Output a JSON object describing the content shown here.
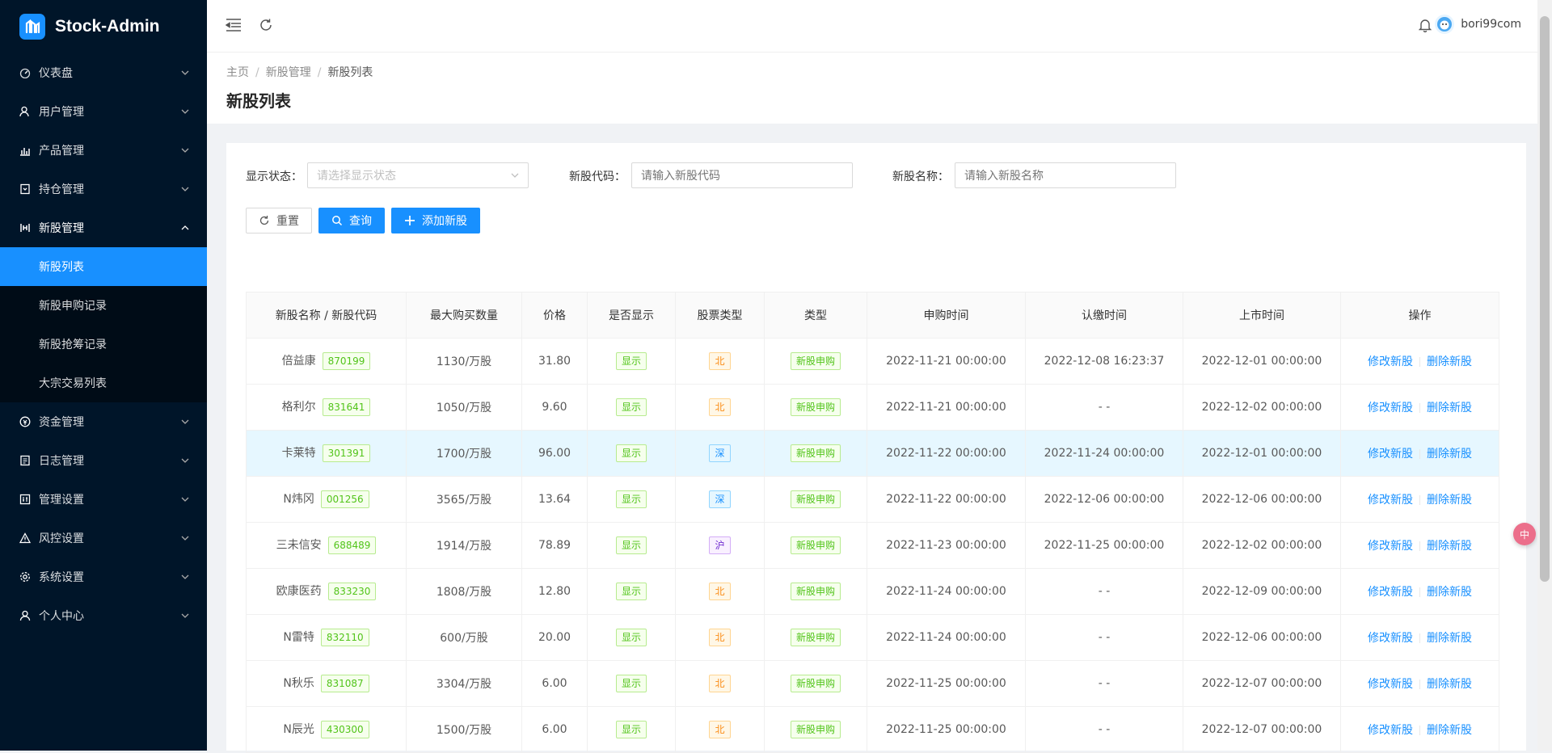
{
  "app": {
    "title": "Stock-Admin"
  },
  "sidebar": {
    "items": [
      {
        "label": "仪表盘",
        "icon": "dashboard-icon"
      },
      {
        "label": "用户管理",
        "icon": "user-manage-icon"
      },
      {
        "label": "产品管理",
        "icon": "chart-icon"
      },
      {
        "label": "持仓管理",
        "icon": "position-icon"
      },
      {
        "label": "新股管理",
        "icon": "ipo-icon",
        "expanded": true,
        "children": [
          {
            "label": "新股列表",
            "active": true
          },
          {
            "label": "新股申购记录"
          },
          {
            "label": "新股抢筹记录"
          },
          {
            "label": "大宗交易列表"
          }
        ]
      },
      {
        "label": "资金管理",
        "icon": "money-icon"
      },
      {
        "label": "日志管理",
        "icon": "log-icon"
      },
      {
        "label": "管理设置",
        "icon": "admin-settings-icon"
      },
      {
        "label": "风控设置",
        "icon": "warning-icon"
      },
      {
        "label": "系统设置",
        "icon": "gear-icon"
      },
      {
        "label": "个人中心",
        "icon": "person-icon"
      }
    ]
  },
  "header": {
    "username": "bori99com"
  },
  "breadcrumb": {
    "home": "主页",
    "parent": "新股管理",
    "current": "新股列表"
  },
  "page": {
    "title": "新股列表"
  },
  "filters": {
    "status_label": "显示状态：",
    "status_placeholder": "请选择显示状态",
    "code_label": "新股代码：",
    "code_placeholder": "请输入新股代码",
    "name_label": "新股名称：",
    "name_placeholder": "请输入新股名称"
  },
  "buttons": {
    "reset": "重置",
    "search": "查询",
    "add": "添加新股"
  },
  "table": {
    "headers": [
      "新股名称 / 新股代码",
      "最大购买数量",
      "价格",
      "是否显示",
      "股票类型",
      "类型",
      "申购时间",
      "认缴时间",
      "上市时间",
      "操作"
    ],
    "rows": [
      {
        "name": "倍益康",
        "code": "870199",
        "max": "1130/万股",
        "price": "31.80",
        "show": "显示",
        "market": "北",
        "type": "新股申购",
        "sub_time": "2022-11-21 00:00:00",
        "pay_time": "2022-12-08 16:23:37",
        "list_time": "2022-12-01 00:00:00"
      },
      {
        "name": "格利尔",
        "code": "831641",
        "max": "1050/万股",
        "price": "9.60",
        "show": "显示",
        "market": "北",
        "type": "新股申购",
        "sub_time": "2022-11-21 00:00:00",
        "pay_time": "- -",
        "list_time": "2022-12-02 00:00:00"
      },
      {
        "name": "卡莱特",
        "code": "301391",
        "max": "1700/万股",
        "price": "96.00",
        "show": "显示",
        "market": "深",
        "type": "新股申购",
        "sub_time": "2022-11-22 00:00:00",
        "pay_time": "2022-11-24 00:00:00",
        "list_time": "2022-12-01 00:00:00"
      },
      {
        "name": "N炜冈",
        "code": "001256",
        "max": "3565/万股",
        "price": "13.64",
        "show": "显示",
        "market": "深",
        "type": "新股申购",
        "sub_time": "2022-11-22 00:00:00",
        "pay_time": "2022-12-06 00:00:00",
        "list_time": "2022-12-06 00:00:00"
      },
      {
        "name": "三未信安",
        "code": "688489",
        "max": "1914/万股",
        "price": "78.89",
        "show": "显示",
        "market": "沪",
        "type": "新股申购",
        "sub_time": "2022-11-23 00:00:00",
        "pay_time": "2022-11-25 00:00:00",
        "list_time": "2022-12-02 00:00:00"
      },
      {
        "name": "欧康医药",
        "code": "833230",
        "max": "1808/万股",
        "price": "12.80",
        "show": "显示",
        "market": "北",
        "type": "新股申购",
        "sub_time": "2022-11-24 00:00:00",
        "pay_time": "- -",
        "list_time": "2022-12-09 00:00:00"
      },
      {
        "name": "N雷特",
        "code": "832110",
        "max": "600/万股",
        "price": "20.00",
        "show": "显示",
        "market": "北",
        "type": "新股申购",
        "sub_time": "2022-11-24 00:00:00",
        "pay_time": "- -",
        "list_time": "2022-12-06 00:00:00"
      },
      {
        "name": "N秋乐",
        "code": "831087",
        "max": "3304/万股",
        "price": "6.00",
        "show": "显示",
        "market": "北",
        "type": "新股申购",
        "sub_time": "2022-11-25 00:00:00",
        "pay_time": "- -",
        "list_time": "2022-12-07 00:00:00"
      },
      {
        "name": "N辰光",
        "code": "430300",
        "max": "1500/万股",
        "price": "6.00",
        "show": "显示",
        "market": "北",
        "type": "新股申购",
        "sub_time": "2022-11-25 00:00:00",
        "pay_time": "- -",
        "list_time": "2022-12-07 00:00:00"
      }
    ],
    "actions": {
      "edit": "修改新股",
      "delete": "删除新股"
    }
  },
  "widget": {
    "label": "中"
  },
  "colors": {
    "primary": "#1890ff",
    "sidebar_bg": "#001529",
    "submenu_bg": "#000c17"
  }
}
